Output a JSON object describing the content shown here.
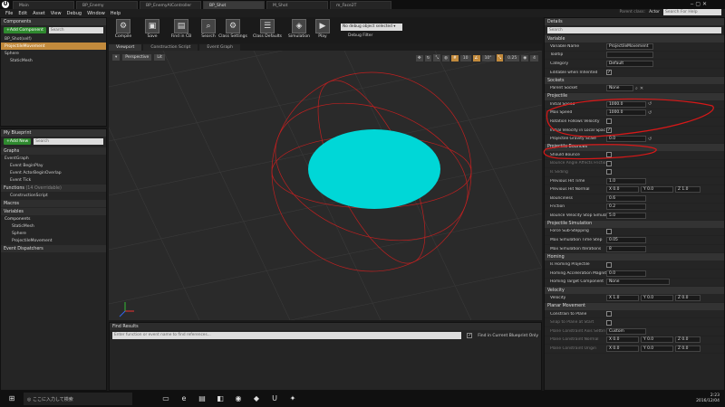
{
  "tabs": [
    "Main",
    "BP_Enemy",
    "BP_EnemyAIController",
    "BP_Shot",
    "M_Shot",
    "m_Face2T"
  ],
  "menu": [
    "File",
    "Edit",
    "Asset",
    "View",
    "Debug",
    "Window",
    "Help"
  ],
  "header": {
    "parent_class_label": "Parent class:",
    "parent_class_value": "Actor",
    "search_placeholder": "Search For Help"
  },
  "components": {
    "title": "Components",
    "add_button": "+Add Component",
    "search": "Search",
    "items": [
      "BP_Shot(self)",
      "ProjectileMovement",
      "Sphere",
      "StaticMesh"
    ]
  },
  "toolbar": {
    "compile": "Compile",
    "save": "Save",
    "find": "Find in CB",
    "search": "Search",
    "class_settings": "Class Settings",
    "class_defaults": "Class Defaults",
    "simulation": "Simulation",
    "play": "Play",
    "debug_select": "No debug object selected",
    "debug_filter": "Debug Filter"
  },
  "viewport": {
    "tabs": [
      "Viewport",
      "Construction Script",
      "Event Graph"
    ],
    "perspective": "Perspective",
    "lit": "Lit",
    "snap": "10",
    "angle": "10°",
    "scale": "0.25",
    "cam": "4",
    "accent": "#00d7d7"
  },
  "my_blueprint": {
    "title": "My Blueprint",
    "add_new": "+Add New",
    "search": "Search",
    "graphs_label": "Graphs",
    "graph": "EventGraph",
    "events": [
      "Event BeginPlay",
      "Event ActorBeginOverlap",
      "Event Tick"
    ],
    "functions_label": "Functions",
    "functions_count": "(14 Overridable)",
    "function": "ConstructionScript",
    "macros": "Macros",
    "variables": "Variables",
    "components_label": "Components",
    "component_items": [
      "StaticMesh",
      "Sphere",
      "ProjectileMovement"
    ],
    "dispatchers": "Event Dispatchers"
  },
  "find_results": {
    "title": "Find Results",
    "placeholder": "Enter function or event name to find references...",
    "checkbox": "Find in Current Blueprint Only"
  },
  "details": {
    "title": "Details",
    "search": "Search",
    "variable": {
      "header": "Variable",
      "name_lbl": "Variable Name",
      "name_val": "ProjectileMovement",
      "tooltip": "Tooltip",
      "category": "Category",
      "category_val": "Default",
      "editable": "Editable when Inherited"
    },
    "sockets": {
      "header": "Sockets",
      "parent": "Parent Socket",
      "parent_val": "None"
    },
    "projectile": {
      "header": "Projectile",
      "initial": "Initial Speed",
      "initial_val": "1000.0",
      "max": "Max Speed",
      "max_val": "1000.0",
      "rot": "Rotation Follows Velocity",
      "local": "Initial Velocity in Local Spac",
      "gravity": "Projectile Gravity Scale",
      "gravity_val": "0.0"
    },
    "bounces": {
      "header": "Projectile Bounces",
      "should": "Should Bounce",
      "angle": "Bounce Angle Affects Frictio",
      "sliding": "Is Sliding",
      "prev_time": "Previous Hit Time",
      "prev_time_val": "1.0",
      "prev_normal": "Previous Hit Normal",
      "normal_x": "X 0.0",
      "normal_y": "Y 0.0",
      "normal_z": "Z 1.0",
      "bounciness": "Bounciness",
      "bounciness_val": "0.6",
      "friction": "Friction",
      "friction_val": "0.2",
      "stop": "Bounce Velocity Stop Simula",
      "stop_val": "5.0"
    },
    "simulation": {
      "header": "Projectile Simulation",
      "force": "Force Sub-Stepping",
      "max_time": "Max Simulation Time Step",
      "max_time_val": "0.05",
      "max_iter": "Max Simulation Iterations",
      "max_iter_val": "8"
    },
    "homing": {
      "header": "Homing",
      "is": "Is Homing Projectile",
      "accel": "Homing Acceleration Magnit",
      "accel_val": "0.0",
      "target": "Homing Target Component",
      "target_val": "None"
    },
    "velocity": {
      "header": "Velocity",
      "lbl": "Velocity",
      "x": "X 1.0",
      "y": "Y 0.0",
      "z": "Z 0.0"
    },
    "planar": {
      "header": "Planar Movement",
      "constrain": "Constrain to Plane",
      "snap": "Snap to Plane at Start",
      "axis": "Plane Constraint Axis Settin",
      "axis_val": "Custom",
      "normal": "Plane Constraint Normal",
      "n_x": "X 0.0",
      "n_y": "Y 0.0",
      "n_z": "Z 0.0",
      "origin": "Plane Constraint Origin",
      "o_x": "X 0.0",
      "o_y": "Y 0.0",
      "o_z": "Z 0.0"
    }
  },
  "taskbar": {
    "search": "ここに入力して検索",
    "time": "2:23",
    "date": "2016/12/04"
  },
  "annotation_color": "#d81818"
}
